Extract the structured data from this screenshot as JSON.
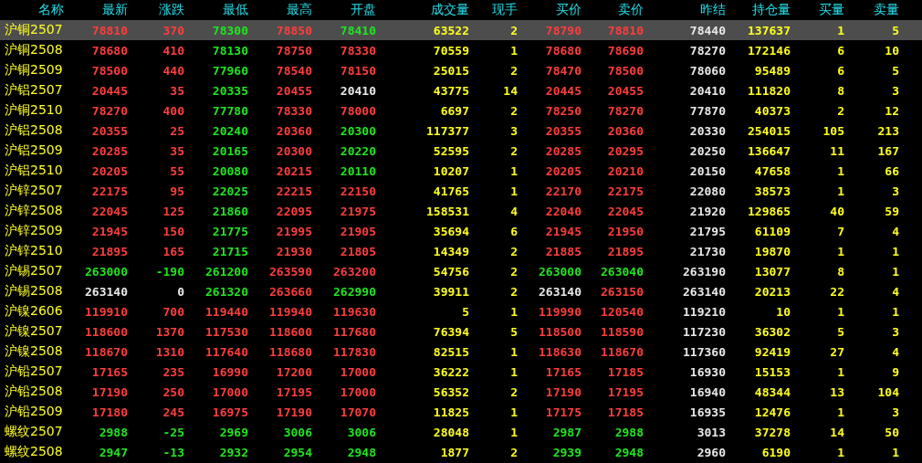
{
  "columns": [
    "名称",
    "最新",
    "涨跌",
    "最低",
    "最高",
    "开盘",
    "成交量",
    "现手",
    "买价",
    "卖价",
    "昨结",
    "持仓量",
    "买量",
    "卖量"
  ],
  "rows": [
    {
      "name": "沪铜2507",
      "selected": true,
      "prices": [
        {
          "v": "78810",
          "color": "#ff3d3d"
        },
        {
          "v": "370",
          "color": "#ff3d3d"
        },
        {
          "v": "78300",
          "color": "#1fe61f"
        },
        {
          "v": "78850",
          "color": "#ff3d3d"
        },
        {
          "v": "78410",
          "color": "#1fe61f"
        }
      ],
      "volume": "63522",
      "hand": "2",
      "bid": {
        "v": "78790",
        "color": "#ff3d3d"
      },
      "ask": {
        "v": "78810",
        "color": "#ff3d3d"
      },
      "settle": "78440",
      "oi": "137637",
      "bid_vol": "1",
      "ask_vol": "5"
    },
    {
      "name": "沪铜2508",
      "selected": false,
      "prices": [
        {
          "v": "78680",
          "color": "#ff3d3d"
        },
        {
          "v": "410",
          "color": "#ff3d3d"
        },
        {
          "v": "78130",
          "color": "#1fe61f"
        },
        {
          "v": "78750",
          "color": "#ff3d3d"
        },
        {
          "v": "78330",
          "color": "#ff3d3d"
        }
      ],
      "volume": "70559",
      "hand": "1",
      "bid": {
        "v": "78680",
        "color": "#ff3d3d"
      },
      "ask": {
        "v": "78690",
        "color": "#ff3d3d"
      },
      "settle": "78270",
      "oi": "172146",
      "bid_vol": "6",
      "ask_vol": "10"
    },
    {
      "name": "沪铜2509",
      "selected": false,
      "prices": [
        {
          "v": "78500",
          "color": "#ff3d3d"
        },
        {
          "v": "440",
          "color": "#ff3d3d"
        },
        {
          "v": "77960",
          "color": "#1fe61f"
        },
        {
          "v": "78540",
          "color": "#ff3d3d"
        },
        {
          "v": "78150",
          "color": "#ff3d3d"
        }
      ],
      "volume": "25015",
      "hand": "2",
      "bid": {
        "v": "78470",
        "color": "#ff3d3d"
      },
      "ask": {
        "v": "78500",
        "color": "#ff3d3d"
      },
      "settle": "78060",
      "oi": "95489",
      "bid_vol": "6",
      "ask_vol": "5"
    },
    {
      "name": "沪铝2507",
      "selected": false,
      "prices": [
        {
          "v": "20445",
          "color": "#ff3d3d"
        },
        {
          "v": "35",
          "color": "#ff3d3d"
        },
        {
          "v": "20335",
          "color": "#1fe61f"
        },
        {
          "v": "20455",
          "color": "#ff3d3d"
        },
        {
          "v": "20410",
          "color": "#e8e8e8"
        }
      ],
      "volume": "43775",
      "hand": "14",
      "bid": {
        "v": "20445",
        "color": "#ff3d3d"
      },
      "ask": {
        "v": "20455",
        "color": "#ff3d3d"
      },
      "settle": "20410",
      "oi": "111820",
      "bid_vol": "8",
      "ask_vol": "3"
    },
    {
      "name": "沪铜2510",
      "selected": false,
      "prices": [
        {
          "v": "78270",
          "color": "#ff3d3d"
        },
        {
          "v": "400",
          "color": "#ff3d3d"
        },
        {
          "v": "77780",
          "color": "#1fe61f"
        },
        {
          "v": "78330",
          "color": "#ff3d3d"
        },
        {
          "v": "78000",
          "color": "#ff3d3d"
        }
      ],
      "volume": "6697",
      "hand": "2",
      "bid": {
        "v": "78250",
        "color": "#ff3d3d"
      },
      "ask": {
        "v": "78270",
        "color": "#ff3d3d"
      },
      "settle": "77870",
      "oi": "40373",
      "bid_vol": "2",
      "ask_vol": "12"
    },
    {
      "name": "沪铝2508",
      "selected": false,
      "prices": [
        {
          "v": "20355",
          "color": "#ff3d3d"
        },
        {
          "v": "25",
          "color": "#ff3d3d"
        },
        {
          "v": "20240",
          "color": "#1fe61f"
        },
        {
          "v": "20360",
          "color": "#ff3d3d"
        },
        {
          "v": "20300",
          "color": "#1fe61f"
        }
      ],
      "volume": "117377",
      "hand": "3",
      "bid": {
        "v": "20355",
        "color": "#ff3d3d"
      },
      "ask": {
        "v": "20360",
        "color": "#ff3d3d"
      },
      "settle": "20330",
      "oi": "254015",
      "bid_vol": "105",
      "ask_vol": "213"
    },
    {
      "name": "沪铝2509",
      "selected": false,
      "prices": [
        {
          "v": "20285",
          "color": "#ff3d3d"
        },
        {
          "v": "35",
          "color": "#ff3d3d"
        },
        {
          "v": "20165",
          "color": "#1fe61f"
        },
        {
          "v": "20300",
          "color": "#ff3d3d"
        },
        {
          "v": "20220",
          "color": "#1fe61f"
        }
      ],
      "volume": "52595",
      "hand": "2",
      "bid": {
        "v": "20285",
        "color": "#ff3d3d"
      },
      "ask": {
        "v": "20295",
        "color": "#ff3d3d"
      },
      "settle": "20250",
      "oi": "136647",
      "bid_vol": "11",
      "ask_vol": "167"
    },
    {
      "name": "沪铝2510",
      "selected": false,
      "prices": [
        {
          "v": "20205",
          "color": "#ff3d3d"
        },
        {
          "v": "55",
          "color": "#ff3d3d"
        },
        {
          "v": "20080",
          "color": "#1fe61f"
        },
        {
          "v": "20215",
          "color": "#ff3d3d"
        },
        {
          "v": "20110",
          "color": "#1fe61f"
        }
      ],
      "volume": "10207",
      "hand": "1",
      "bid": {
        "v": "20205",
        "color": "#ff3d3d"
      },
      "ask": {
        "v": "20210",
        "color": "#ff3d3d"
      },
      "settle": "20150",
      "oi": "47658",
      "bid_vol": "1",
      "ask_vol": "66"
    },
    {
      "name": "沪锌2507",
      "selected": false,
      "prices": [
        {
          "v": "22175",
          "color": "#ff3d3d"
        },
        {
          "v": "95",
          "color": "#ff3d3d"
        },
        {
          "v": "22025",
          "color": "#1fe61f"
        },
        {
          "v": "22215",
          "color": "#ff3d3d"
        },
        {
          "v": "22150",
          "color": "#ff3d3d"
        }
      ],
      "volume": "41765",
      "hand": "1",
      "bid": {
        "v": "22170",
        "color": "#ff3d3d"
      },
      "ask": {
        "v": "22175",
        "color": "#ff3d3d"
      },
      "settle": "22080",
      "oi": "38573",
      "bid_vol": "1",
      "ask_vol": "3"
    },
    {
      "name": "沪锌2508",
      "selected": false,
      "prices": [
        {
          "v": "22045",
          "color": "#ff3d3d"
        },
        {
          "v": "125",
          "color": "#ff3d3d"
        },
        {
          "v": "21860",
          "color": "#1fe61f"
        },
        {
          "v": "22095",
          "color": "#ff3d3d"
        },
        {
          "v": "21975",
          "color": "#ff3d3d"
        }
      ],
      "volume": "158531",
      "hand": "4",
      "bid": {
        "v": "22040",
        "color": "#ff3d3d"
      },
      "ask": {
        "v": "22045",
        "color": "#ff3d3d"
      },
      "settle": "21920",
      "oi": "129865",
      "bid_vol": "40",
      "ask_vol": "59"
    },
    {
      "name": "沪锌2509",
      "selected": false,
      "prices": [
        {
          "v": "21945",
          "color": "#ff3d3d"
        },
        {
          "v": "150",
          "color": "#ff3d3d"
        },
        {
          "v": "21775",
          "color": "#1fe61f"
        },
        {
          "v": "21995",
          "color": "#ff3d3d"
        },
        {
          "v": "21905",
          "color": "#ff3d3d"
        }
      ],
      "volume": "35694",
      "hand": "6",
      "bid": {
        "v": "21945",
        "color": "#ff3d3d"
      },
      "ask": {
        "v": "21950",
        "color": "#ff3d3d"
      },
      "settle": "21795",
      "oi": "61109",
      "bid_vol": "7",
      "ask_vol": "4"
    },
    {
      "name": "沪锌2510",
      "selected": false,
      "prices": [
        {
          "v": "21895",
          "color": "#ff3d3d"
        },
        {
          "v": "165",
          "color": "#ff3d3d"
        },
        {
          "v": "21715",
          "color": "#1fe61f"
        },
        {
          "v": "21930",
          "color": "#ff3d3d"
        },
        {
          "v": "21805",
          "color": "#ff3d3d"
        }
      ],
      "volume": "14349",
      "hand": "2",
      "bid": {
        "v": "21885",
        "color": "#ff3d3d"
      },
      "ask": {
        "v": "21895",
        "color": "#ff3d3d"
      },
      "settle": "21730",
      "oi": "19870",
      "bid_vol": "1",
      "ask_vol": "1"
    },
    {
      "name": "沪锡2507",
      "selected": false,
      "prices": [
        {
          "v": "263000",
          "color": "#1fe61f"
        },
        {
          "v": "-190",
          "color": "#1fe61f"
        },
        {
          "v": "261200",
          "color": "#1fe61f"
        },
        {
          "v": "263590",
          "color": "#ff3d3d"
        },
        {
          "v": "263200",
          "color": "#ff3d3d"
        }
      ],
      "volume": "54756",
      "hand": "2",
      "bid": {
        "v": "263000",
        "color": "#1fe61f"
      },
      "ask": {
        "v": "263040",
        "color": "#1fe61f"
      },
      "settle": "263190",
      "oi": "13077",
      "bid_vol": "8",
      "ask_vol": "1"
    },
    {
      "name": "沪锡2508",
      "selected": false,
      "prices": [
        {
          "v": "263140",
          "color": "#e8e8e8"
        },
        {
          "v": "0",
          "color": "#e8e8e8"
        },
        {
          "v": "261320",
          "color": "#1fe61f"
        },
        {
          "v": "263660",
          "color": "#ff3d3d"
        },
        {
          "v": "262990",
          "color": "#1fe61f"
        }
      ],
      "volume": "39911",
      "hand": "2",
      "bid": {
        "v": "263140",
        "color": "#e8e8e8"
      },
      "ask": {
        "v": "263150",
        "color": "#ff3d3d"
      },
      "settle": "263140",
      "oi": "20213",
      "bid_vol": "22",
      "ask_vol": "4"
    },
    {
      "name": "沪镍2606",
      "selected": false,
      "prices": [
        {
          "v": "119910",
          "color": "#ff3d3d"
        },
        {
          "v": "700",
          "color": "#ff3d3d"
        },
        {
          "v": "119440",
          "color": "#ff3d3d"
        },
        {
          "v": "119940",
          "color": "#ff3d3d"
        },
        {
          "v": "119630",
          "color": "#ff3d3d"
        }
      ],
      "volume": "5",
      "hand": "1",
      "bid": {
        "v": "119990",
        "color": "#ff3d3d"
      },
      "ask": {
        "v": "120540",
        "color": "#ff3d3d"
      },
      "settle": "119210",
      "oi": "10",
      "bid_vol": "1",
      "ask_vol": "1"
    },
    {
      "name": "沪镍2507",
      "selected": false,
      "prices": [
        {
          "v": "118600",
          "color": "#ff3d3d"
        },
        {
          "v": "1370",
          "color": "#ff3d3d"
        },
        {
          "v": "117530",
          "color": "#ff3d3d"
        },
        {
          "v": "118600",
          "color": "#ff3d3d"
        },
        {
          "v": "117680",
          "color": "#ff3d3d"
        }
      ],
      "volume": "76394",
      "hand": "5",
      "bid": {
        "v": "118500",
        "color": "#ff3d3d"
      },
      "ask": {
        "v": "118590",
        "color": "#ff3d3d"
      },
      "settle": "117230",
      "oi": "36302",
      "bid_vol": "5",
      "ask_vol": "3"
    },
    {
      "name": "沪镍2508",
      "selected": false,
      "prices": [
        {
          "v": "118670",
          "color": "#ff3d3d"
        },
        {
          "v": "1310",
          "color": "#ff3d3d"
        },
        {
          "v": "117640",
          "color": "#ff3d3d"
        },
        {
          "v": "118680",
          "color": "#ff3d3d"
        },
        {
          "v": "117830",
          "color": "#ff3d3d"
        }
      ],
      "volume": "82515",
      "hand": "1",
      "bid": {
        "v": "118630",
        "color": "#ff3d3d"
      },
      "ask": {
        "v": "118670",
        "color": "#ff3d3d"
      },
      "settle": "117360",
      "oi": "92419",
      "bid_vol": "27",
      "ask_vol": "4"
    },
    {
      "name": "沪铅2507",
      "selected": false,
      "prices": [
        {
          "v": "17165",
          "color": "#ff3d3d"
        },
        {
          "v": "235",
          "color": "#ff3d3d"
        },
        {
          "v": "16990",
          "color": "#ff3d3d"
        },
        {
          "v": "17200",
          "color": "#ff3d3d"
        },
        {
          "v": "17000",
          "color": "#ff3d3d"
        }
      ],
      "volume": "36222",
      "hand": "1",
      "bid": {
        "v": "17165",
        "color": "#ff3d3d"
      },
      "ask": {
        "v": "17185",
        "color": "#ff3d3d"
      },
      "settle": "16930",
      "oi": "15153",
      "bid_vol": "1",
      "ask_vol": "9"
    },
    {
      "name": "沪铅2508",
      "selected": false,
      "prices": [
        {
          "v": "17190",
          "color": "#ff3d3d"
        },
        {
          "v": "250",
          "color": "#ff3d3d"
        },
        {
          "v": "17000",
          "color": "#ff3d3d"
        },
        {
          "v": "17195",
          "color": "#ff3d3d"
        },
        {
          "v": "17000",
          "color": "#ff3d3d"
        }
      ],
      "volume": "56352",
      "hand": "2",
      "bid": {
        "v": "17190",
        "color": "#ff3d3d"
      },
      "ask": {
        "v": "17195",
        "color": "#ff3d3d"
      },
      "settle": "16940",
      "oi": "48344",
      "bid_vol": "13",
      "ask_vol": "104"
    },
    {
      "name": "沪铅2509",
      "selected": false,
      "prices": [
        {
          "v": "17180",
          "color": "#ff3d3d"
        },
        {
          "v": "245",
          "color": "#ff3d3d"
        },
        {
          "v": "16975",
          "color": "#ff3d3d"
        },
        {
          "v": "17190",
          "color": "#ff3d3d"
        },
        {
          "v": "17070",
          "color": "#ff3d3d"
        }
      ],
      "volume": "11825",
      "hand": "1",
      "bid": {
        "v": "17175",
        "color": "#ff3d3d"
      },
      "ask": {
        "v": "17185",
        "color": "#ff3d3d"
      },
      "settle": "16935",
      "oi": "12476",
      "bid_vol": "1",
      "ask_vol": "3"
    },
    {
      "name": "螺纹2507",
      "selected": false,
      "prices": [
        {
          "v": "2988",
          "color": "#1fe61f"
        },
        {
          "v": "-25",
          "color": "#1fe61f"
        },
        {
          "v": "2969",
          "color": "#1fe61f"
        },
        {
          "v": "3006",
          "color": "#1fe61f"
        },
        {
          "v": "3006",
          "color": "#1fe61f"
        }
      ],
      "volume": "28048",
      "hand": "1",
      "bid": {
        "v": "2987",
        "color": "#1fe61f"
      },
      "ask": {
        "v": "2988",
        "color": "#1fe61f"
      },
      "settle": "3013",
      "oi": "37278",
      "bid_vol": "14",
      "ask_vol": "50"
    },
    {
      "name": "螺纹2508",
      "selected": false,
      "prices": [
        {
          "v": "2947",
          "color": "#1fe61f"
        },
        {
          "v": "-13",
          "color": "#1fe61f"
        },
        {
          "v": "2932",
          "color": "#1fe61f"
        },
        {
          "v": "2954",
          "color": "#1fe61f"
        },
        {
          "v": "2948",
          "color": "#1fe61f"
        }
      ],
      "volume": "1877",
      "hand": "2",
      "bid": {
        "v": "2939",
        "color": "#1fe61f"
      },
      "ask": {
        "v": "2948",
        "color": "#1fe61f"
      },
      "settle": "2960",
      "oi": "6190",
      "bid_vol": "1",
      "ask_vol": "1"
    }
  ]
}
